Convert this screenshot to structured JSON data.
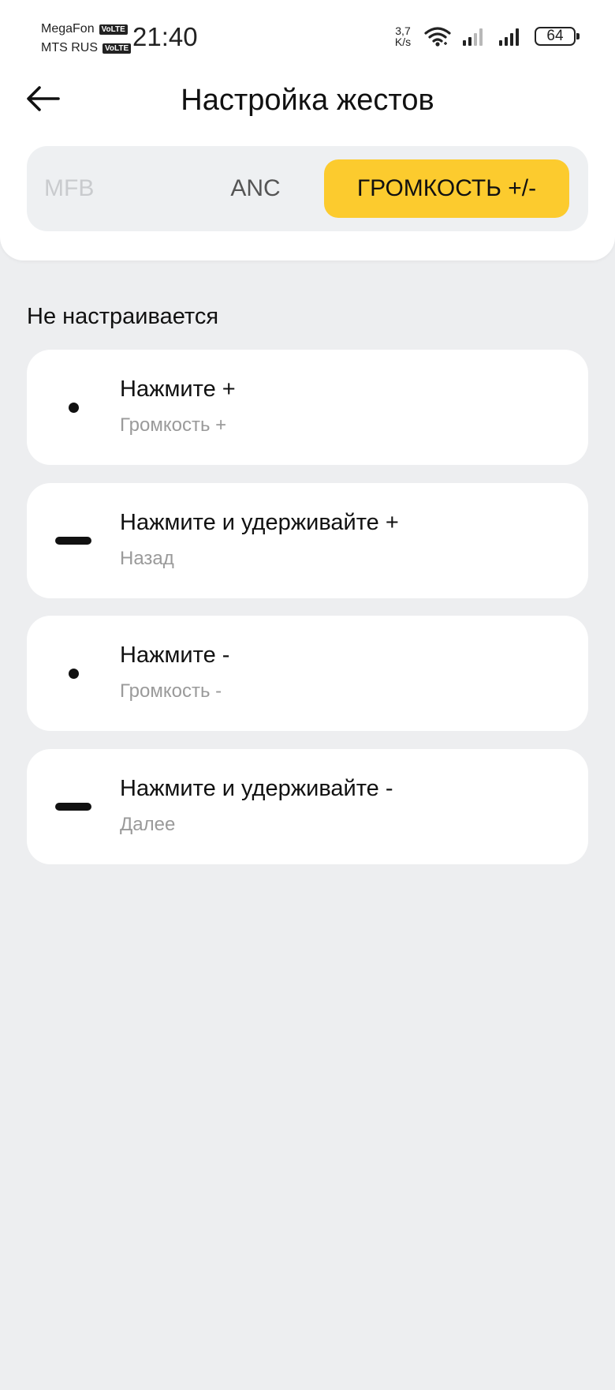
{
  "status_bar": {
    "carrier1": "MegaFon",
    "carrier2": "MTS RUS",
    "volte": "VoLTE",
    "time": "21:40",
    "net_speed_value": "3,7",
    "net_speed_unit": "K/s",
    "battery": "64",
    "icons": [
      "wifi-icon",
      "signal-icon",
      "signal-icon"
    ]
  },
  "header": {
    "title": "Настройка жестов",
    "back_icon": "arrow-left-icon"
  },
  "tabs": [
    {
      "label": "MFB",
      "state": "disabled"
    },
    {
      "label": "ANC",
      "state": "normal"
    },
    {
      "label": "ГРОМКОСТЬ +/-",
      "state": "selected"
    }
  ],
  "colors": {
    "accent": "#fccb2e",
    "background": "#edeef0",
    "card": "#ffffff",
    "subtitle": "#9a9a9a"
  },
  "section_title": "Не настраивается",
  "gestures": [
    {
      "icon": "dot-icon",
      "title": "Нажмите +",
      "action": "Громкость +"
    },
    {
      "icon": "dash-icon",
      "title": "Нажмите и удерживайте +",
      "action": "Назад"
    },
    {
      "icon": "dot-icon",
      "title": "Нажмите -",
      "action": "Громкость -"
    },
    {
      "icon": "dash-icon",
      "title": "Нажмите и удерживайте -",
      "action": "Далее"
    }
  ]
}
